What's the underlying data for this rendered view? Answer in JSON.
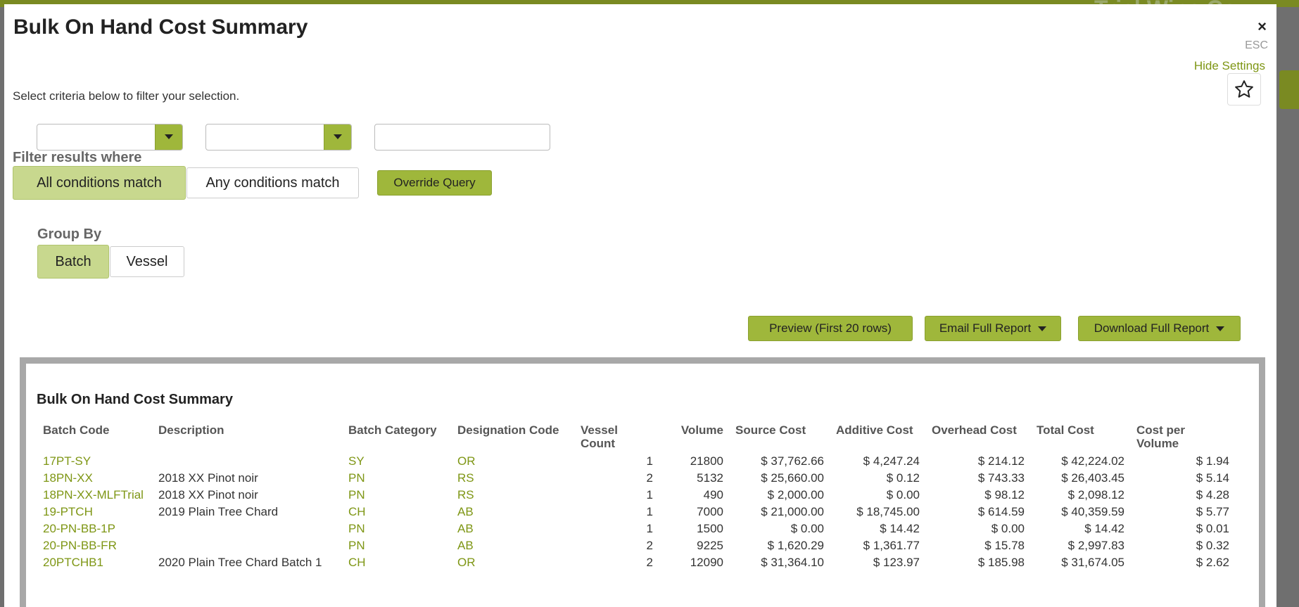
{
  "background": {
    "brand": "Trial Wine Co"
  },
  "modal": {
    "title": "Bulk On Hand Cost Summary",
    "close_label": "×",
    "esc_label": "ESC",
    "hide_settings": "Hide Settings",
    "instruction": "Select criteria below to filter your selection.",
    "filters": {
      "field_select": "",
      "operator_select": "",
      "value_input": ""
    },
    "filter_label": "Filter results where",
    "match_options": [
      "All conditions match",
      "Any conditions match"
    ],
    "match_selected": "All conditions match",
    "override_query": "Override Query",
    "group_by_label": "Group By",
    "group_by_options": [
      "Batch",
      "Vessel"
    ],
    "group_by_selected": "Batch",
    "actions": {
      "preview": "Preview (First 20 rows)",
      "email": "Email Full Report",
      "download": "Download Full Report"
    }
  },
  "report": {
    "title": "Bulk On Hand Cost Summary",
    "columns": [
      "Batch Code",
      "Description",
      "Batch Category",
      "Designation Code",
      "Vessel Count",
      "Volume",
      "Source Cost",
      "Additive Cost",
      "Overhead Cost",
      "Total Cost",
      "Cost per Volume"
    ],
    "rows": [
      {
        "batch": "17PT-SY",
        "desc": "",
        "cat": "SY",
        "desig": "OR",
        "count": "1",
        "volume": "21800",
        "source": "$ 37,762.66",
        "additive": "$ 4,247.24",
        "overhead": "$ 214.12",
        "total": "$ 42,224.02",
        "cpv": "$ 1.94"
      },
      {
        "batch": "18PN-XX",
        "desc": "2018 XX Pinot noir",
        "cat": "PN",
        "desig": "RS",
        "count": "2",
        "volume": "5132",
        "source": "$ 25,660.00",
        "additive": "$ 0.12",
        "overhead": "$ 743.33",
        "total": "$ 26,403.45",
        "cpv": "$ 5.14"
      },
      {
        "batch": "18PN-XX-MLFTrial",
        "desc": "2018 XX Pinot noir",
        "cat": "PN",
        "desig": "RS",
        "count": "1",
        "volume": "490",
        "source": "$ 2,000.00",
        "additive": "$ 0.00",
        "overhead": "$ 98.12",
        "total": "$ 2,098.12",
        "cpv": "$ 4.28"
      },
      {
        "batch": "19-PTCH",
        "desc": "2019 Plain Tree Chard",
        "cat": "CH",
        "desig": "AB",
        "count": "1",
        "volume": "7000",
        "source": "$ 21,000.00",
        "additive": "$ 18,745.00",
        "overhead": "$ 614.59",
        "total": "$ 40,359.59",
        "cpv": "$ 5.77"
      },
      {
        "batch": "20-PN-BB-1P",
        "desc": "",
        "cat": "PN",
        "desig": "AB",
        "count": "1",
        "volume": "1500",
        "source": "$ 0.00",
        "additive": "$ 14.42",
        "overhead": "$ 0.00",
        "total": "$ 14.42",
        "cpv": "$ 0.01"
      },
      {
        "batch": "20-PN-BB-FR",
        "desc": "",
        "cat": "PN",
        "desig": "AB",
        "count": "2",
        "volume": "9225",
        "source": "$ 1,620.29",
        "additive": "$ 1,361.77",
        "overhead": "$ 15.78",
        "total": "$ 2,997.83",
        "cpv": "$ 0.32"
      },
      {
        "batch": "20PTCHB1",
        "desc": "2020 Plain Tree Chard Batch 1",
        "cat": "CH",
        "desig": "OR",
        "count": "2",
        "volume": "12090",
        "source": "$ 31,364.10",
        "additive": "$ 123.97",
        "overhead": "$ 185.98",
        "total": "$ 31,674.05",
        "cpv": "$ 2.62"
      }
    ]
  }
}
